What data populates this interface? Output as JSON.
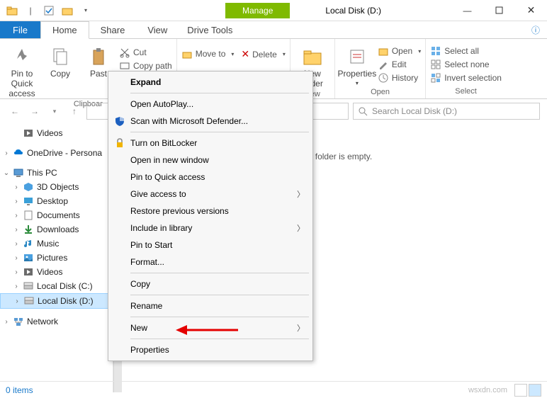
{
  "title": "Local Disk (D:)",
  "manage_label": "Manage",
  "ribbon_tabs": {
    "file": "File",
    "home": "Home",
    "share": "Share",
    "view": "View",
    "drive_tools": "Drive Tools"
  },
  "ribbon": {
    "pin": "Pin to Quick access",
    "copy": "Copy",
    "paste": "Past",
    "cut": "Cut",
    "copy_path": "Copy path",
    "clipboard": "Clipboar",
    "move_to": "Move to",
    "delete": "Delete",
    "new_folder": "New folder",
    "new": "New",
    "properties": "Properties",
    "open": "Open",
    "edit": "Edit",
    "history": "History",
    "open_group": "Open",
    "select_all": "Select all",
    "select_none": "Select none",
    "invert": "Invert selection",
    "select_group": "Select"
  },
  "search_placeholder": "Search Local Disk (D:)",
  "empty_message": "This folder is empty.",
  "sidebar": {
    "videos": "Videos",
    "onedrive": "OneDrive - Persona",
    "this_pc": "This PC",
    "objects3d": "3D Objects",
    "desktop": "Desktop",
    "documents": "Documents",
    "downloads": "Downloads",
    "music": "Music",
    "pictures": "Pictures",
    "videos2": "Videos",
    "local_c": "Local Disk (C:)",
    "local_d": "Local Disk (D:)",
    "network": "Network"
  },
  "context_menu": {
    "expand": "Expand",
    "autoplay": "Open AutoPlay...",
    "defender": "Scan with Microsoft Defender...",
    "bitlocker": "Turn on BitLocker",
    "new_window": "Open in new window",
    "pin_quick": "Pin to Quick access",
    "give_access": "Give access to",
    "restore": "Restore previous versions",
    "include": "Include in library",
    "pin_start": "Pin to Start",
    "format": "Format...",
    "copy": "Copy",
    "rename": "Rename",
    "new": "New",
    "properties": "Properties"
  },
  "status": {
    "items": "0 items"
  },
  "watermark": "wsxdn.com"
}
